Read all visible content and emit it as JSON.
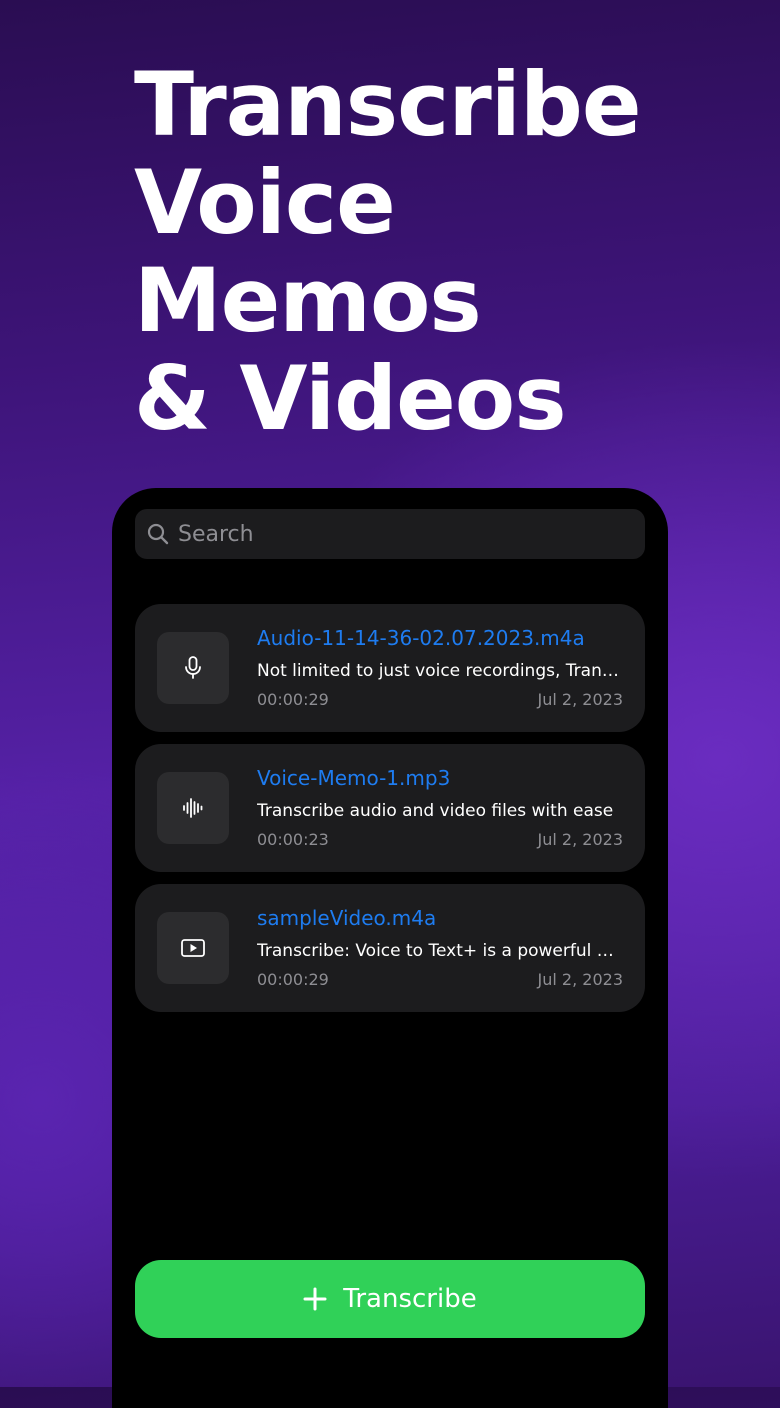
{
  "headline": {
    "line1": "Transcribe",
    "line2": "Voice",
    "line3": "Memos",
    "line4": "& Videos"
  },
  "search": {
    "placeholder": "Search"
  },
  "items": [
    {
      "icon": "microphone-icon",
      "title": "Audio-11-14-36-02.07.2023.m4a",
      "description": "Not limited to just voice recordings, Transcribe",
      "duration": "00:00:29",
      "date": "Jul 2, 2023"
    },
    {
      "icon": "waveform-icon",
      "title": "Voice-Memo-1.mp3",
      "description": "Transcribe audio and video files with ease",
      "duration": "00:00:23",
      "date": "Jul 2, 2023"
    },
    {
      "icon": "video-play-icon",
      "title": "sampleVideo.m4a",
      "description": "Transcribe: Voice to Text+ is a powerful app",
      "duration": "00:00:29",
      "date": "Jul 2, 2023"
    }
  ],
  "button": {
    "label": "Transcribe",
    "icon": "plus-icon"
  },
  "colors": {
    "accent_blue": "#1e7cf0",
    "button_green": "#30d158",
    "card_background": "#1c1c1e",
    "phone_background": "#000000"
  }
}
